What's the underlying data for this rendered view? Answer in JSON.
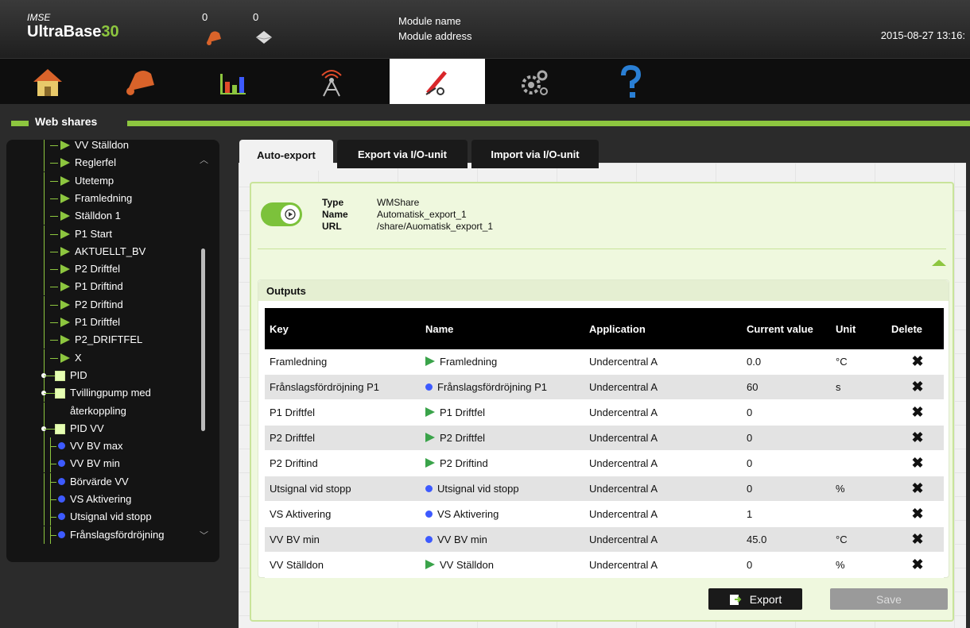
{
  "header": {
    "brand_sub": "IMSE",
    "brand_main": "UltraBase",
    "brand_num": "30",
    "alarm_count": "0",
    "message_count": "0",
    "module_name": "Module name",
    "module_address": "Module address",
    "datetime": "2015-08-27 13:16:"
  },
  "nav": {
    "items": [
      {
        "icon": "home-icon"
      },
      {
        "icon": "alarm-bell-icon"
      },
      {
        "icon": "bar-chart-icon"
      },
      {
        "icon": "antenna-icon"
      },
      {
        "icon": "tools-icon",
        "active": true
      },
      {
        "icon": "gears-icon"
      },
      {
        "icon": "help-icon"
      }
    ]
  },
  "section": {
    "title": "Web shares"
  },
  "tree": {
    "items": [
      {
        "label": "VV Ställdon",
        "type": "tri"
      },
      {
        "label": "Reglerfel",
        "type": "tri"
      },
      {
        "label": "Utetemp",
        "type": "tri"
      },
      {
        "label": "Framledning",
        "type": "tri"
      },
      {
        "label": "Ställdon 1",
        "type": "tri"
      },
      {
        "label": "P1 Start",
        "type": "tri"
      },
      {
        "label": "AKTUELLT_BV",
        "type": "tri"
      },
      {
        "label": "P2 Driftfel",
        "type": "tri"
      },
      {
        "label": "P1 Driftind",
        "type": "tri"
      },
      {
        "label": "P2 Driftind",
        "type": "tri"
      },
      {
        "label": "P1 Driftfel",
        "type": "tri"
      },
      {
        "label": "P2_DRIFTFEL",
        "type": "tri"
      },
      {
        "label": "X",
        "type": "tri"
      },
      {
        "label": "PID",
        "type": "box"
      },
      {
        "label": "Tvillingpump med",
        "type": "box"
      },
      {
        "label": "återkoppling",
        "type": "cont"
      },
      {
        "label": "PID VV",
        "type": "box"
      },
      {
        "label": "VV BV max",
        "type": "dot"
      },
      {
        "label": "VV BV min",
        "type": "dot"
      },
      {
        "label": "Börvärde VV",
        "type": "dot"
      },
      {
        "label": "VS Aktivering",
        "type": "dot"
      },
      {
        "label": "Utsignal vid stopp",
        "type": "dot"
      },
      {
        "label": "Frånslagsfördröjning",
        "type": "dot"
      }
    ]
  },
  "tabs": [
    {
      "label": "Auto-export",
      "active": true
    },
    {
      "label": "Export via I/O-unit"
    },
    {
      "label": "Import via I/O-unit"
    }
  ],
  "share": {
    "type_label": "Type",
    "type_value": "WMShare",
    "name_label": "Name",
    "name_value": "Automatisk_export_1",
    "url_label": "URL",
    "url_value": "/share/Auomatisk_export_1",
    "enabled": true
  },
  "outputs": {
    "title": "Outputs",
    "columns": [
      "Key",
      "Name",
      "Application",
      "Current value",
      "Unit",
      "Delete"
    ],
    "rows": [
      {
        "key": "Framledning",
        "name": "Framledning",
        "marker": "tri",
        "application": "Undercentral A",
        "value": "0.0",
        "unit": "°C"
      },
      {
        "key": "Frånslagsfördröjning P1",
        "name": "Frånslagsfördröjning P1",
        "marker": "dot",
        "application": "Undercentral A",
        "value": "60",
        "unit": "s"
      },
      {
        "key": "P1 Driftfel",
        "name": "P1 Driftfel",
        "marker": "tri",
        "application": "Undercentral A",
        "value": "0",
        "unit": ""
      },
      {
        "key": "P2 Driftfel",
        "name": "P2 Driftfel",
        "marker": "tri",
        "application": "Undercentral A",
        "value": "0",
        "unit": ""
      },
      {
        "key": "P2 Driftind",
        "name": "P2 Driftind",
        "marker": "tri",
        "application": "Undercentral A",
        "value": "0",
        "unit": ""
      },
      {
        "key": "Utsignal vid stopp",
        "name": "Utsignal vid stopp",
        "marker": "dot",
        "application": "Undercentral A",
        "value": "0",
        "unit": "%"
      },
      {
        "key": "VS Aktivering",
        "name": "VS Aktivering",
        "marker": "dot",
        "application": "Undercentral A",
        "value": "1",
        "unit": ""
      },
      {
        "key": "VV BV min",
        "name": "VV BV min",
        "marker": "dot",
        "application": "Undercentral A",
        "value": "45.0",
        "unit": "°C"
      },
      {
        "key": "VV Ställdon",
        "name": "VV Ställdon",
        "marker": "tri",
        "application": "Undercentral A",
        "value": "0",
        "unit": "%"
      }
    ],
    "delete_glyph": "✖"
  },
  "buttons": {
    "export_label": "Export",
    "save_label": "Save"
  }
}
